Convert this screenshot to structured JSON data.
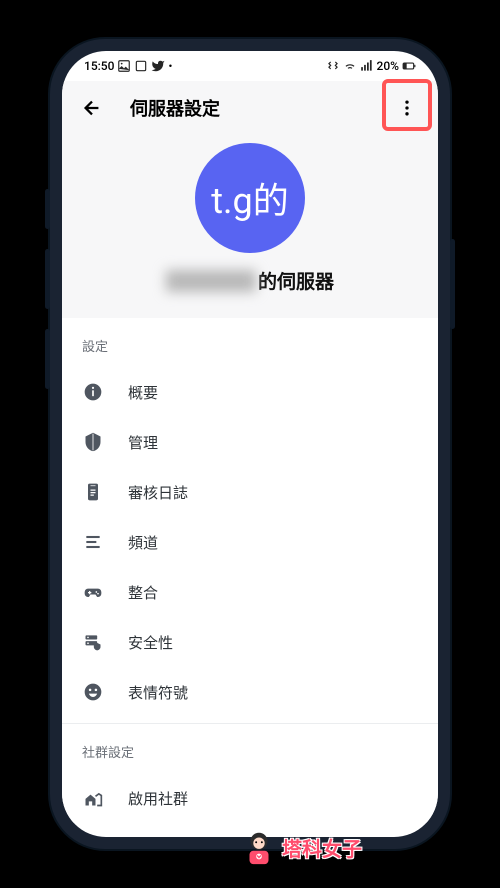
{
  "status": {
    "time": "15:50",
    "battery": "20%"
  },
  "header": {
    "title": "伺服器設定"
  },
  "server": {
    "avatar_text": "t.g的",
    "name_suffix": "的伺服器"
  },
  "sections": {
    "settings_header": "設定",
    "community_header": "社群設定"
  },
  "items": {
    "overview": "概要",
    "moderation": "管理",
    "audit_log": "審核日誌",
    "channels": "頻道",
    "integrations": "整合",
    "security": "安全性",
    "emoji": "表情符號",
    "enable_community": "啟用社群"
  },
  "watermark": "塔科女子"
}
